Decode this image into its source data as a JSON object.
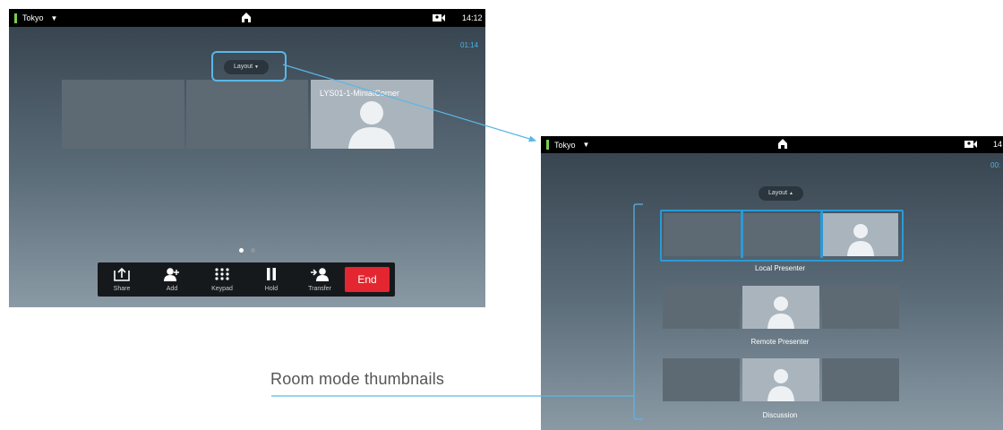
{
  "left_screen": {
    "location": "Tokyo",
    "time": "14:12",
    "call_timer": "01:14",
    "layout_button": "Layout",
    "participant_name": "LYS01-1-MiniatCorner",
    "call_controls": {
      "share": "Share",
      "add": "Add",
      "keypad": "Keypad",
      "hold": "Hold",
      "transfer": "Transfer",
      "end": "End"
    }
  },
  "right_screen": {
    "location": "Tokyo",
    "time": "14",
    "call_timer": "00:",
    "layout_button": "Layout",
    "modes": [
      {
        "label": "Local Presenter"
      },
      {
        "label": "Remote Presenter"
      },
      {
        "label": "Discussion"
      }
    ]
  },
  "annotation": {
    "label": "Room mode thumbnails"
  },
  "colors": {
    "accent": "#4db3e6",
    "end_button": "#e3262f",
    "status_green": "#7ad04e"
  }
}
